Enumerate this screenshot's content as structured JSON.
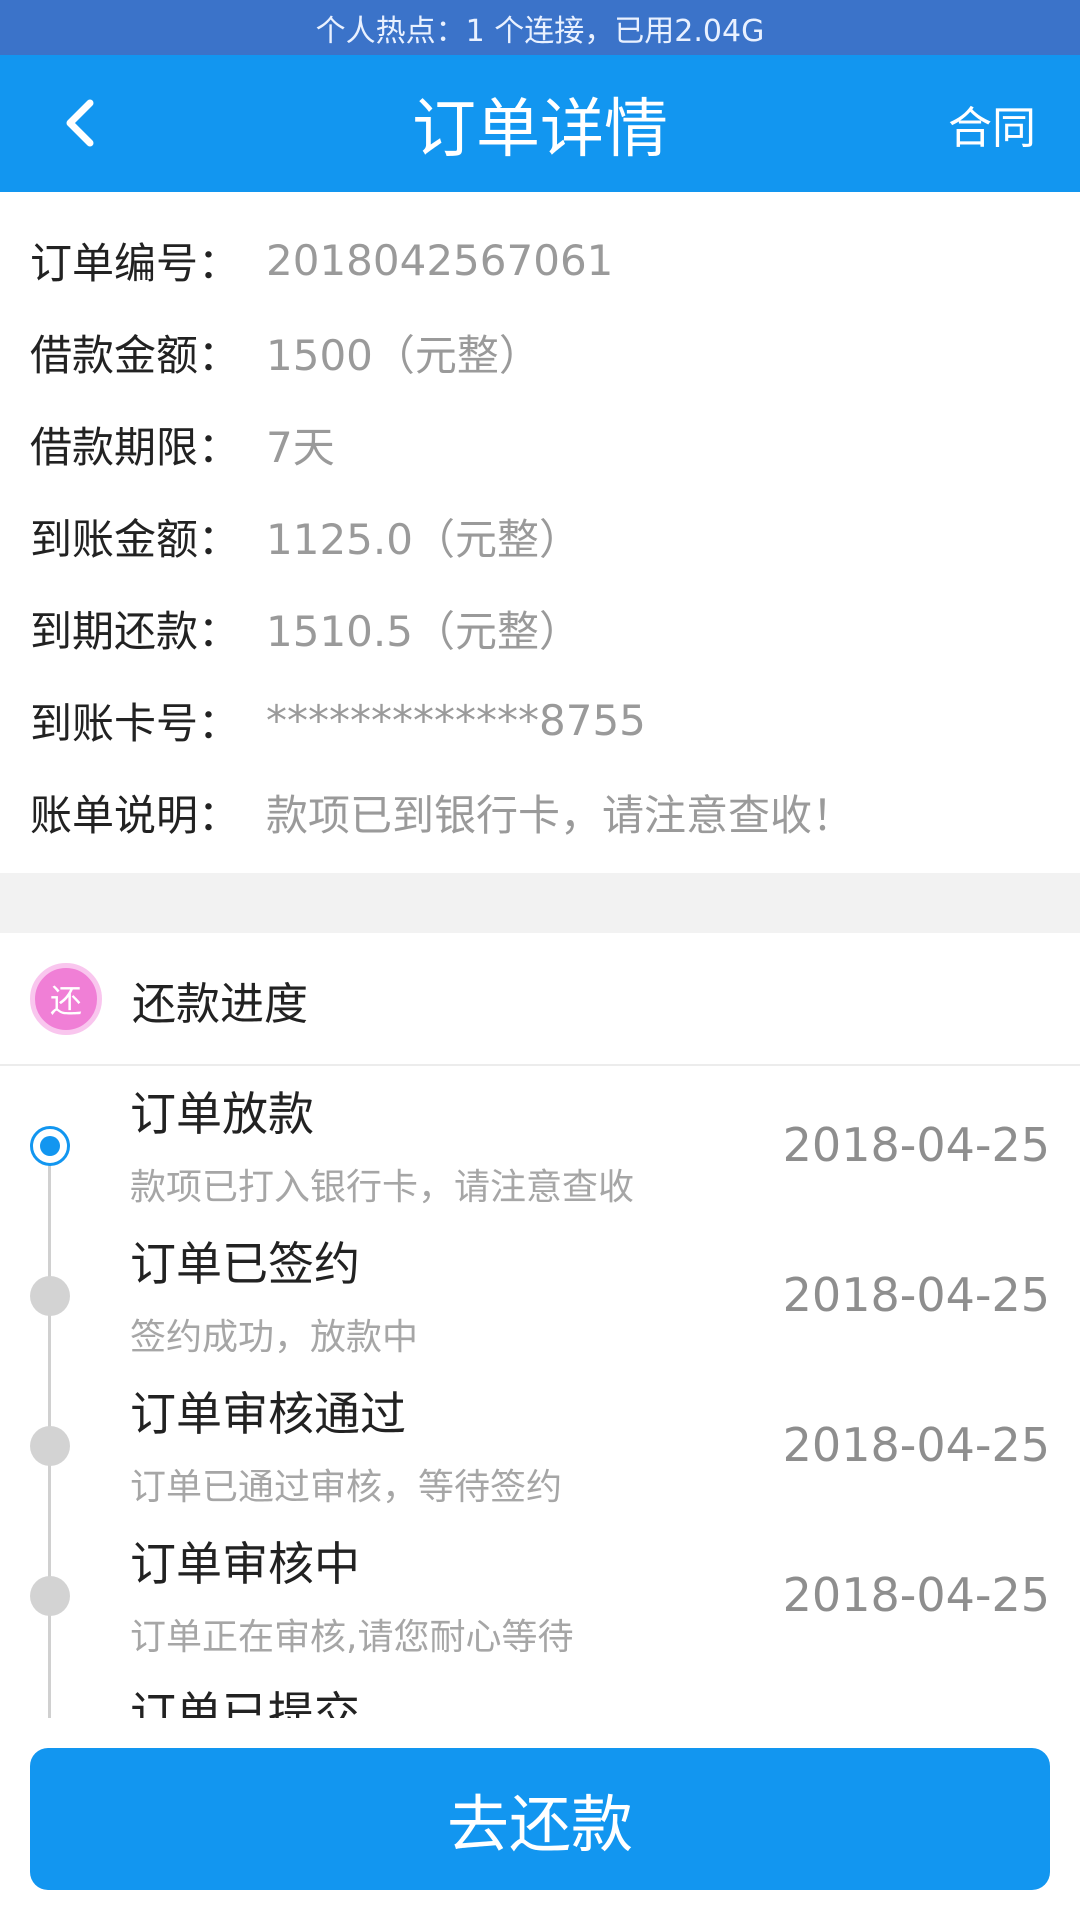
{
  "status_bar": {
    "text": "个人热点：1 个连接，已用2.04G"
  },
  "nav": {
    "back_icon": "chevron-left-icon",
    "title": "订单详情",
    "contract_label": "合同"
  },
  "order_info": {
    "rows": [
      {
        "label": "订单编号：",
        "value": "2018042567061"
      },
      {
        "label": "借款金额：",
        "value": "1500（元整）"
      },
      {
        "label": "借款期限：",
        "value": "7天"
      },
      {
        "label": "到账金额：",
        "value": "1125.0（元整）"
      },
      {
        "label": "到期还款：",
        "value": "1510.5（元整）"
      },
      {
        "label": "到账卡号：",
        "value": "*************8755"
      },
      {
        "label": "账单说明：",
        "value": "款项已到银行卡，请注意查收！"
      }
    ]
  },
  "progress": {
    "icon_text": "还",
    "icon_color": "#f07fd6",
    "title": "还款进度",
    "steps": [
      {
        "title": "订单放款",
        "desc": "款项已打入银行卡，请注意查收",
        "date": "2018-04-25",
        "active": true
      },
      {
        "title": "订单已签约",
        "desc": "签约成功，放款中",
        "date": "2018-04-25",
        "active": false
      },
      {
        "title": "订单审核通过",
        "desc": "订单已通过审核，等待签约",
        "date": "2018-04-25",
        "active": false
      },
      {
        "title": "订单审核中",
        "desc": "订单正在审核,请您耐心等待",
        "date": "2018-04-25",
        "active": false
      },
      {
        "title": "订单已提交",
        "desc": "",
        "date": "",
        "active": false
      }
    ]
  },
  "repay_button": {
    "label": "去还款"
  },
  "colors": {
    "accent": "#1296f0",
    "status_bar": "#3b73c9"
  }
}
